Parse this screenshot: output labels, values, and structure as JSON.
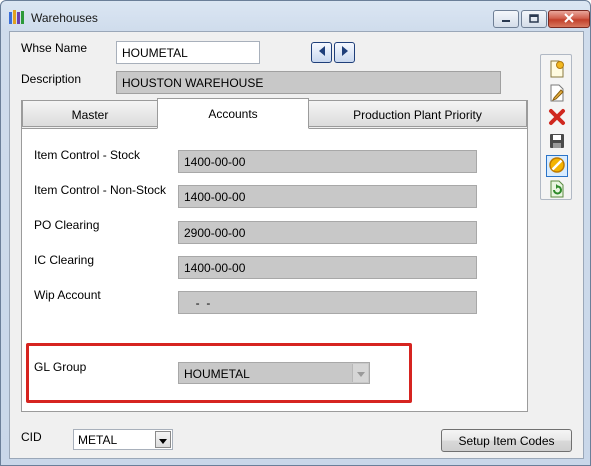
{
  "window": {
    "title": "Warehouses"
  },
  "header": {
    "whse_name_label": "Whse Name",
    "whse_name_value": "HOUMETAL",
    "description_label": "Description",
    "description_value": "HOUSTON WAREHOUSE"
  },
  "tabs": [
    {
      "label": "Master",
      "active": false
    },
    {
      "label": "Accounts",
      "active": true
    },
    {
      "label": "Production Plant Priority",
      "active": false
    }
  ],
  "accounts": {
    "fields": [
      {
        "label": "Item Control - Stock",
        "value": "1400-00-00"
      },
      {
        "label": "Item Control - Non-Stock",
        "value": "1400-00-00"
      },
      {
        "label": "PO Clearing",
        "value": "2900-00-00"
      },
      {
        "label": "IC Clearing",
        "value": "1400-00-00"
      },
      {
        "label": "Wip Account",
        "value": "  -  -"
      }
    ],
    "gl_group_label": "GL Group",
    "gl_group_value": "HOUMETAL"
  },
  "footer": {
    "cid_label": "CID",
    "cid_value": "METAL",
    "setup_button": "Setup Item Codes"
  },
  "toolbar_icons": [
    "new-icon",
    "edit-icon",
    "delete-icon",
    "save-icon",
    "cancel-icon",
    "refresh-icon"
  ],
  "colors": {
    "highlight": "#d62420",
    "readonly_bg": "#c8c8c8",
    "nav_arrow": "#1f3f7a"
  }
}
